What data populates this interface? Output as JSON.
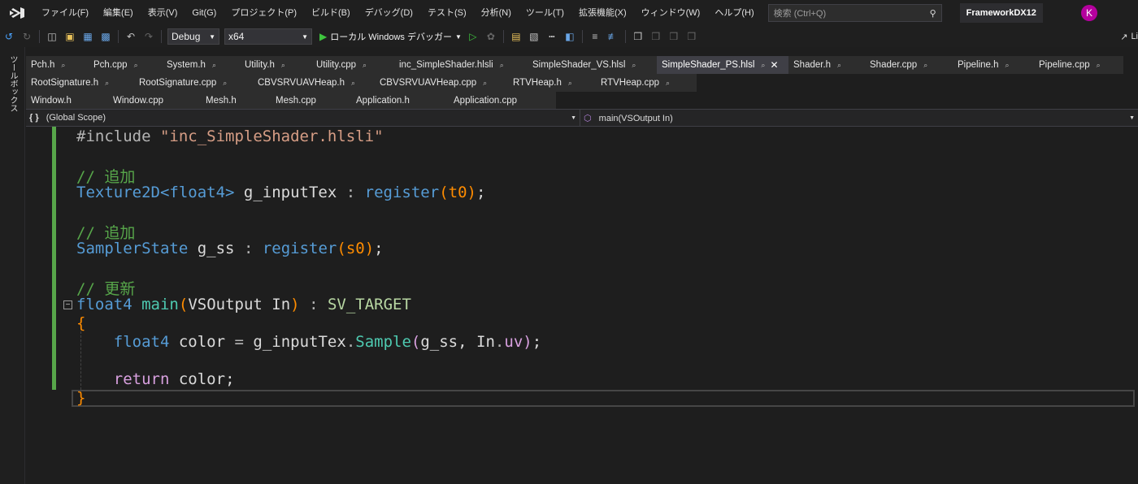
{
  "menubar": {
    "items": [
      "ファイル(F)",
      "編集(E)",
      "表示(V)",
      "Git(G)",
      "プロジェクト(P)",
      "ビルド(B)",
      "デバッグ(D)",
      "テスト(S)",
      "分析(N)",
      "ツール(T)",
      "拡張機能(X)",
      "ウィンドウ(W)",
      "ヘルプ(H)"
    ],
    "search_placeholder": "検索 (Ctrl+Q)",
    "solution_name": "FrameworkDX12",
    "avatar_initial": "K"
  },
  "toolbar": {
    "config": "Debug",
    "platform": "x64",
    "run_label": "ローカル Windows デバッガー",
    "live_label": "Li"
  },
  "side": {
    "label": "ツールボックス"
  },
  "tabs": {
    "row1": [
      "Pch.h",
      "Pch.cpp",
      "System.h",
      "Utility.h",
      "Utility.cpp",
      "inc_SimpleShader.hlsli",
      "SimpleShader_VS.hlsl",
      "SimpleShader_PS.hlsl",
      "Shader.h",
      "Shader.cpp",
      "Pipeline.h",
      "Pipeline.cpp"
    ],
    "row2": [
      "RootSignature.h",
      "RootSignature.cpp",
      "CBVSRVUAVHeap.h",
      "CBVSRVUAVHeap.cpp",
      "RTVHeap.h",
      "RTVHeap.cpp"
    ],
    "row3": [
      "Window.h",
      "Window.cpp",
      "Mesh.h",
      "Mesh.cpp",
      "Application.h",
      "Application.cpp"
    ],
    "active": "SimpleShader_PS.hlsl"
  },
  "navbar": {
    "scope_icon": "{ }",
    "scope": "(Global Scope)",
    "member": "main(VSOutput In)"
  },
  "code": {
    "l1_kw": "#include",
    "l1_str": "\"inc_SimpleShader.hlsli\"",
    "c1": "// 追加",
    "l2_type": "Texture2D",
    "l2_tmpl": "<float4>",
    "l2_name": "g_inputTex",
    "l2_colon": ":",
    "l2_reg": "register",
    "l2_arg": "t0",
    "c2": "// 追加",
    "l3_type": "SamplerState",
    "l3_name": "g_ss",
    "l3_reg": "register",
    "l3_arg": "s0",
    "c3": "// 更新",
    "l4_type": "float4",
    "l4_fn": "main",
    "l4_ptype": "VSOutput",
    "l4_pname": "In",
    "l4_sem": "SV_TARGET",
    "brace_open": "{",
    "l5_type": "float4",
    "l5_var": "color",
    "l5_obj": "g_inputTex",
    "l5_method": "Sample",
    "l5_a1": "g_ss",
    "l5_a2": "In",
    "l5_mem": "uv",
    "l6_kw": "return",
    "l6_var": "color",
    "brace_close": "}"
  }
}
